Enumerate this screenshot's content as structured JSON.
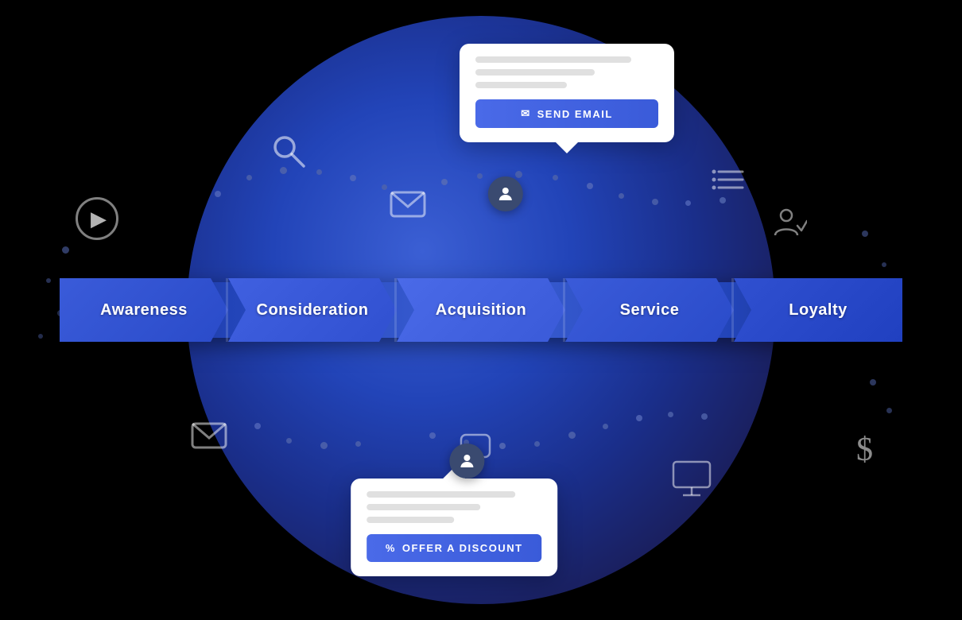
{
  "pipeline": {
    "steps": [
      {
        "id": "awareness",
        "label": "Awareness"
      },
      {
        "id": "consideration",
        "label": "Consideration"
      },
      {
        "id": "acquisition",
        "label": "Acquisition"
      },
      {
        "id": "service",
        "label": "Service"
      },
      {
        "id": "loyalty",
        "label": "Loyalty"
      }
    ]
  },
  "card_top": {
    "button_label": "SEND EMAIL",
    "button_icon": "✉"
  },
  "card_bottom": {
    "button_label": "OFFER A DISCOUNT",
    "button_icon": "%"
  },
  "icons": {
    "search": "🔍",
    "mail": "✉",
    "list": "≡",
    "person_check": "✓",
    "chat": "💬",
    "monitor": "🖥",
    "dollar": "$",
    "play": "▶"
  }
}
